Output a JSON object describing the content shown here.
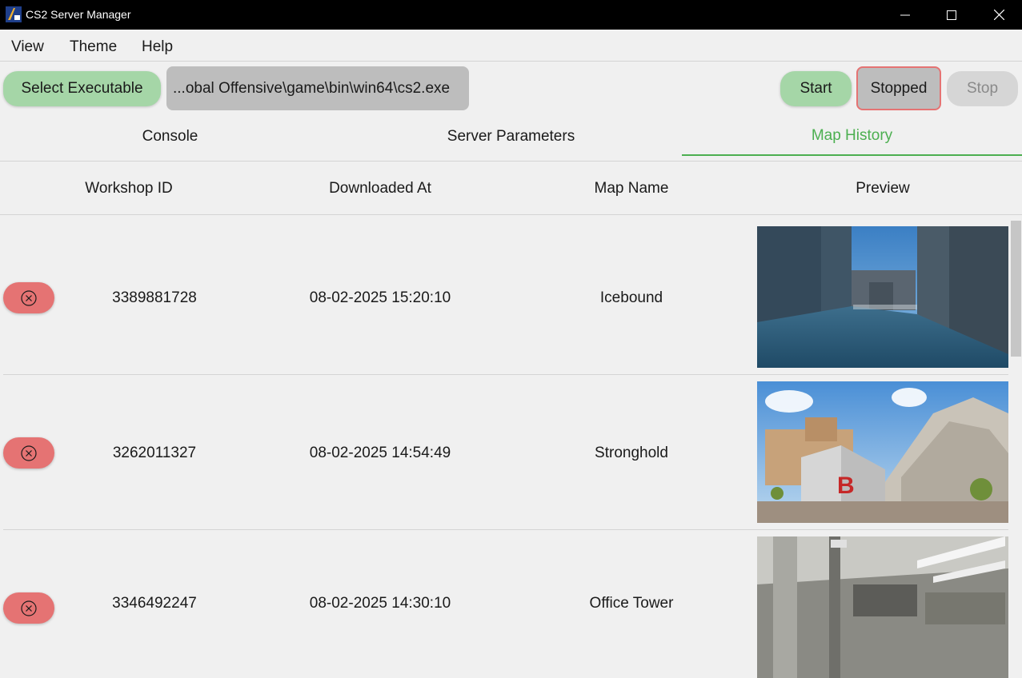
{
  "window": {
    "title": "CS2 Server Manager"
  },
  "menu": {
    "items": [
      "View",
      "Theme",
      "Help"
    ]
  },
  "toolbar": {
    "select_label": "Select Executable",
    "path_value": "...obal Offensive\\game\\bin\\win64\\cs2.exe",
    "start_label": "Start",
    "status_label": "Stopped",
    "stop_label": "Stop"
  },
  "tabs": [
    {
      "label": "Console"
    },
    {
      "label": "Server Parameters"
    },
    {
      "label": "Map History"
    }
  ],
  "table": {
    "headers": [
      "Workshop ID",
      "Downloaded At",
      "Map Name",
      "Preview"
    ],
    "rows": [
      {
        "workshop_id": "3389881728",
        "downloaded_at": "08-02-2025 15:20:10",
        "map_name": "Icebound"
      },
      {
        "workshop_id": "3262011327",
        "downloaded_at": "08-02-2025 14:54:49",
        "map_name": "Stronghold"
      },
      {
        "workshop_id": "3346492247",
        "downloaded_at": "08-02-2025 14:30:10",
        "map_name": "Office Tower"
      }
    ]
  },
  "colors": {
    "accent_green": "#4caf50",
    "button_green": "#a5d6a7",
    "status_red": "#e57373",
    "path_bg": "#bdbdbd"
  }
}
